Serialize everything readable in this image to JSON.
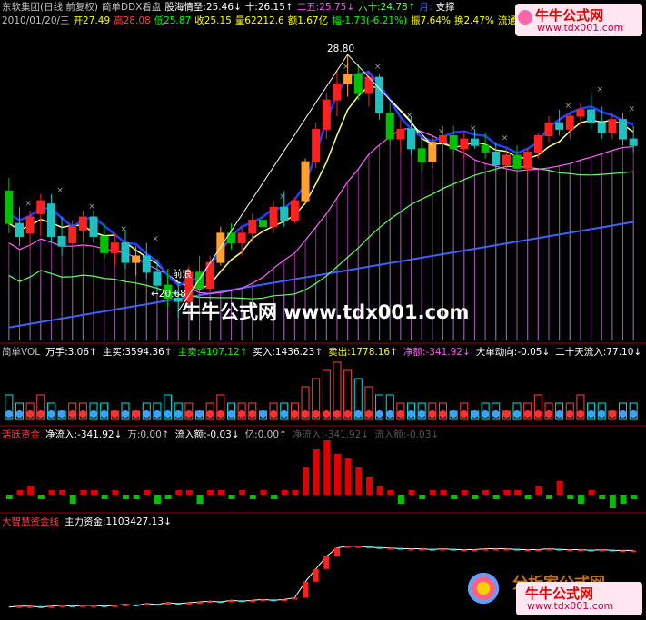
{
  "header": {
    "line1": [
      {
        "text": "东软集团(日线 前复权)",
        "color": "#c0c0c0"
      },
      {
        "text": "简单DDX看盘",
        "color": "#c0c0c0"
      },
      {
        "text": "股海情圣:25.46↓",
        "color": "#ffffff"
      },
      {
        "text": "十:26.15↑",
        "color": "#ffffff"
      },
      {
        "text": "二五:25.75↓",
        "color": "#ff55ff"
      },
      {
        "text": "六十:24.78↑",
        "color": "#55ff55"
      },
      {
        "text": "月:",
        "color": "#4060ff"
      },
      {
        "text": "支撑",
        "color": "#ffffff"
      }
    ],
    "line2": [
      {
        "text": "2010/01/20/三",
        "color": "#c0c0c0"
      },
      {
        "text": "开27.49",
        "color": "#ffff00"
      },
      {
        "text": "高28.08",
        "color": "#ff4040"
      },
      {
        "text": "低25.87",
        "color": "#00ff00"
      },
      {
        "text": "收25.15",
        "color": "#ffff00"
      },
      {
        "text": "量62212.6",
        "color": "#ffff00"
      },
      {
        "text": "额1.67亿",
        "color": "#ffff00"
      },
      {
        "text": "幅-1.73(-6.21%)",
        "color": "#00ff00"
      },
      {
        "text": "振7.64%",
        "color": "#ffff00"
      },
      {
        "text": "换2.47%",
        "color": "#ffff00"
      },
      {
        "text": "流通2.52",
        "color": "#ffff00"
      }
    ]
  },
  "annotations": {
    "high_label": "28.80",
    "low_label": "←20.68",
    "pullback_label": "前浪"
  },
  "vol_panel": {
    "items": [
      {
        "text": "简单VOL",
        "color": "#c0c0c0"
      },
      {
        "text": "万手:3.06↑",
        "color": "#ffffff"
      },
      {
        "text": "主买:3594.36↑",
        "color": "#ffffff"
      },
      {
        "text": "主卖:4107.12↑",
        "color": "#00ff00"
      },
      {
        "text": "买入:1436.23↑",
        "color": "#ffffff"
      },
      {
        "text": "卖出:1778.16↑",
        "color": "#ffff00"
      },
      {
        "text": "净额:-341.92↓",
        "color": "#ff55ff"
      },
      {
        "text": "大单动向:-0.05↓",
        "color": "#ffffff"
      },
      {
        "text": "二十天流入:77.10↓",
        "color": "#ffffff"
      }
    ]
  },
  "fund_panel": {
    "items": [
      {
        "text": "活跃资金",
        "color": "#ff4040"
      },
      {
        "text": "净流入:-341.92↓",
        "color": "#ffffff"
      },
      {
        "text": "万:0.00↑",
        "color": "#c0c0c0"
      },
      {
        "text": "流入额:-0.03↓",
        "color": "#ffffff"
      },
      {
        "text": "亿:0.00↑",
        "color": "#c0c0c0"
      },
      {
        "text": "净流入:-341.92↓",
        "color": "#555555"
      },
      {
        "text": "流入额:-0.03↓",
        "color": "#555555"
      }
    ]
  },
  "smart_panel": {
    "items": [
      {
        "text": "大智慧资金线",
        "color": "#ff4040"
      },
      {
        "text": "主力资金:1103427.13↓",
        "color": "#ffffff"
      }
    ]
  },
  "watermarks": {
    "center": "牛牛公式网 www.tdx001.com",
    "top_right_title": "牛牛公式网",
    "top_right_url": "www.tdx001.com",
    "bottom_right_title": "牛牛公式网",
    "bottom_right_url": "www.tdx001.com",
    "bottom_brand": "分析家公式网"
  },
  "colors": {
    "up": "#ff2020",
    "down": "#00ffff",
    "yellow": "#ffff00",
    "ma_white": "#ffffff",
    "ma_pink": "#ff55ff",
    "ma_green": "#55ff55",
    "ma_blue": "#3050ff",
    "bg": "#000000"
  },
  "chart_data": {
    "type": "candlestick",
    "title": "东软集团(日线 前复权)",
    "price_range": [
      20.0,
      29.5
    ],
    "candles": [
      {
        "o": 24.6,
        "h": 25.0,
        "l": 23.3,
        "c": 23.6
      },
      {
        "o": 23.6,
        "h": 24.1,
        "l": 22.9,
        "c": 23.2
      },
      {
        "o": 23.3,
        "h": 24.0,
        "l": 22.8,
        "c": 23.8
      },
      {
        "o": 23.9,
        "h": 24.5,
        "l": 23.2,
        "c": 24.3
      },
      {
        "o": 24.2,
        "h": 24.5,
        "l": 23.0,
        "c": 23.2
      },
      {
        "o": 23.2,
        "h": 23.8,
        "l": 22.6,
        "c": 22.9
      },
      {
        "o": 23.0,
        "h": 23.7,
        "l": 22.8,
        "c": 23.5
      },
      {
        "o": 23.4,
        "h": 24.0,
        "l": 23.0,
        "c": 23.8
      },
      {
        "o": 23.8,
        "h": 24.0,
        "l": 23.0,
        "c": 23.2
      },
      {
        "o": 23.2,
        "h": 23.6,
        "l": 22.5,
        "c": 22.7
      },
      {
        "o": 22.7,
        "h": 23.3,
        "l": 22.3,
        "c": 23.0
      },
      {
        "o": 23.0,
        "h": 23.4,
        "l": 22.2,
        "c": 22.4
      },
      {
        "o": 22.4,
        "h": 22.9,
        "l": 22.0,
        "c": 22.6
      },
      {
        "o": 22.6,
        "h": 23.0,
        "l": 21.9,
        "c": 22.1
      },
      {
        "o": 22.1,
        "h": 22.5,
        "l": 21.4,
        "c": 21.7
      },
      {
        "o": 21.7,
        "h": 22.2,
        "l": 21.0,
        "c": 21.3
      },
      {
        "o": 21.3,
        "h": 21.8,
        "l": 20.7,
        "c": 21.2
      },
      {
        "o": 21.2,
        "h": 22.3,
        "l": 21.0,
        "c": 22.1
      },
      {
        "o": 22.1,
        "h": 22.6,
        "l": 21.3,
        "c": 21.6
      },
      {
        "o": 21.6,
        "h": 22.6,
        "l": 21.4,
        "c": 22.4
      },
      {
        "o": 22.4,
        "h": 23.5,
        "l": 22.3,
        "c": 23.3
      },
      {
        "o": 23.3,
        "h": 23.6,
        "l": 22.8,
        "c": 23.0
      },
      {
        "o": 23.0,
        "h": 23.5,
        "l": 22.6,
        "c": 23.3
      },
      {
        "o": 23.3,
        "h": 23.9,
        "l": 23.0,
        "c": 23.7
      },
      {
        "o": 23.7,
        "h": 24.2,
        "l": 23.3,
        "c": 23.5
      },
      {
        "o": 23.5,
        "h": 24.3,
        "l": 23.3,
        "c": 24.1
      },
      {
        "o": 24.1,
        "h": 24.6,
        "l": 23.5,
        "c": 23.7
      },
      {
        "o": 23.7,
        "h": 24.4,
        "l": 23.6,
        "c": 24.3
      },
      {
        "o": 24.3,
        "h": 25.6,
        "l": 24.2,
        "c": 25.5
      },
      {
        "o": 25.5,
        "h": 26.7,
        "l": 25.3,
        "c": 26.5
      },
      {
        "o": 26.5,
        "h": 27.6,
        "l": 26.2,
        "c": 27.4
      },
      {
        "o": 27.4,
        "h": 28.3,
        "l": 26.9,
        "c": 27.9
      },
      {
        "o": 27.9,
        "h": 28.8,
        "l": 27.5,
        "c": 28.2
      },
      {
        "o": 28.2,
        "h": 28.5,
        "l": 27.4,
        "c": 27.6
      },
      {
        "o": 27.6,
        "h": 28.3,
        "l": 27.2,
        "c": 28.1
      },
      {
        "o": 28.1,
        "h": 28.2,
        "l": 26.8,
        "c": 27.0
      },
      {
        "o": 27.0,
        "h": 27.3,
        "l": 26.0,
        "c": 26.2
      },
      {
        "o": 26.2,
        "h": 26.8,
        "l": 25.8,
        "c": 26.5
      },
      {
        "o": 26.5,
        "h": 26.9,
        "l": 25.7,
        "c": 25.9
      },
      {
        "o": 25.9,
        "h": 26.2,
        "l": 25.2,
        "c": 25.5
      },
      {
        "o": 25.5,
        "h": 26.3,
        "l": 25.3,
        "c": 26.1
      },
      {
        "o": 26.1,
        "h": 26.6,
        "l": 25.8,
        "c": 26.3
      },
      {
        "o": 26.3,
        "h": 26.6,
        "l": 25.7,
        "c": 25.9
      },
      {
        "o": 25.9,
        "h": 26.4,
        "l": 25.6,
        "c": 26.2
      },
      {
        "o": 26.2,
        "h": 26.5,
        "l": 25.9,
        "c": 26.0
      },
      {
        "o": 26.0,
        "h": 26.4,
        "l": 25.6,
        "c": 25.8
      },
      {
        "o": 25.8,
        "h": 26.1,
        "l": 25.2,
        "c": 25.4
      },
      {
        "o": 25.4,
        "h": 25.9,
        "l": 25.0,
        "c": 25.7
      },
      {
        "o": 25.7,
        "h": 26.0,
        "l": 25.2,
        "c": 25.3
      },
      {
        "o": 25.3,
        "h": 25.9,
        "l": 25.1,
        "c": 25.8
      },
      {
        "o": 25.8,
        "h": 26.4,
        "l": 25.6,
        "c": 26.3
      },
      {
        "o": 26.3,
        "h": 26.9,
        "l": 26.1,
        "c": 26.7
      },
      {
        "o": 26.7,
        "h": 27.1,
        "l": 26.3,
        "c": 26.5
      },
      {
        "o": 26.5,
        "h": 27.0,
        "l": 26.2,
        "c": 26.9
      },
      {
        "o": 26.9,
        "h": 27.3,
        "l": 26.6,
        "c": 27.1
      },
      {
        "o": 27.1,
        "h": 27.6,
        "l": 26.5,
        "c": 26.7
      },
      {
        "o": 26.7,
        "h": 27.2,
        "l": 26.2,
        "c": 26.4
      },
      {
        "o": 26.4,
        "h": 27.0,
        "l": 26.2,
        "c": 26.8
      },
      {
        "o": 26.8,
        "h": 27.0,
        "l": 26.0,
        "c": 26.2
      },
      {
        "o": 26.2,
        "h": 26.6,
        "l": 25.8,
        "c": 26.0
      }
    ],
    "volume": [
      3,
      2,
      2,
      3,
      2,
      1,
      2,
      2,
      2,
      2,
      1,
      2,
      1,
      2,
      2,
      3,
      2,
      2,
      1,
      2,
      3,
      2,
      2,
      2,
      1,
      2,
      2,
      2,
      4,
      5,
      6,
      7,
      6,
      5,
      4,
      3,
      3,
      2,
      2,
      2,
      2,
      2,
      1,
      2,
      1,
      2,
      2,
      1,
      2,
      2,
      3,
      2,
      2,
      2,
      3,
      2,
      2,
      1,
      2,
      2
    ],
    "active_funds": [
      -1,
      1,
      2,
      -1,
      1,
      1,
      -2,
      1,
      1,
      -1,
      1,
      -1,
      -1,
      1,
      -2,
      -1,
      1,
      1,
      -2,
      1,
      1,
      -1,
      1,
      -1,
      1,
      -1,
      1,
      1,
      6,
      10,
      12,
      9,
      8,
      6,
      4,
      2,
      1,
      -2,
      1,
      -1,
      1,
      1,
      -1,
      1,
      -1,
      1,
      -1,
      1,
      1,
      -1,
      2,
      -1,
      3,
      -1,
      -2,
      1,
      -1,
      -3,
      -2,
      -1
    ],
    "smart_money_line": [
      10,
      11,
      11,
      10,
      11,
      12,
      11,
      12,
      12,
      11,
      12,
      13,
      12,
      14,
      13,
      15,
      14,
      15,
      16,
      17,
      16,
      18,
      17,
      18,
      19,
      18,
      19,
      21,
      40,
      55,
      70,
      80,
      82,
      82,
      81,
      80,
      80,
      79,
      79,
      79,
      78,
      79,
      78,
      78,
      78,
      79,
      79,
      79,
      78,
      78,
      78,
      79,
      78,
      78,
      78,
      77,
      78,
      77,
      77,
      77
    ]
  }
}
